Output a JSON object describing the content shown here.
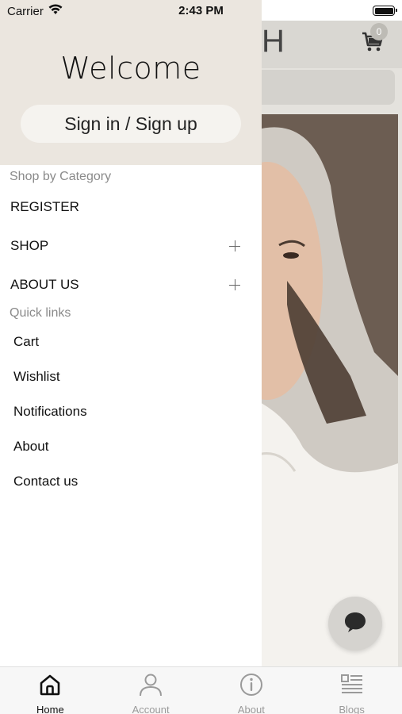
{
  "status_bar": {
    "carrier": "Carrier",
    "time": "2:43 PM"
  },
  "background_page": {
    "logo_fragment": "H",
    "cart_count": "0"
  },
  "drawer": {
    "welcome": "Welcome",
    "signin_label": "Sign in / Sign up",
    "shop_by_category_label": "Shop by Category",
    "categories": [
      {
        "label": "REGISTER",
        "expandable": false
      },
      {
        "label": "SHOP",
        "expandable": true
      },
      {
        "label": "ABOUT US",
        "expandable": true
      }
    ],
    "quick_links_label": "Quick links",
    "quick_links": [
      {
        "label": "Cart"
      },
      {
        "label": "Wishlist"
      },
      {
        "label": "Notifications"
      },
      {
        "label": "About"
      },
      {
        "label": "Contact us"
      }
    ]
  },
  "tabbar": {
    "tabs": [
      {
        "label": "Home",
        "icon": "home-icon",
        "active": true
      },
      {
        "label": "Account",
        "icon": "account-icon",
        "active": false
      },
      {
        "label": "About",
        "icon": "info-icon",
        "active": false
      },
      {
        "label": "Blogs",
        "icon": "blogs-icon",
        "active": false
      }
    ]
  },
  "colors": {
    "drawer_header_bg": "#ebe6df",
    "signin_button_bg": "#f5f3ef",
    "section_label": "#8a8a8a",
    "tab_active": "#111111",
    "tab_inactive": "#9a9a9a"
  }
}
